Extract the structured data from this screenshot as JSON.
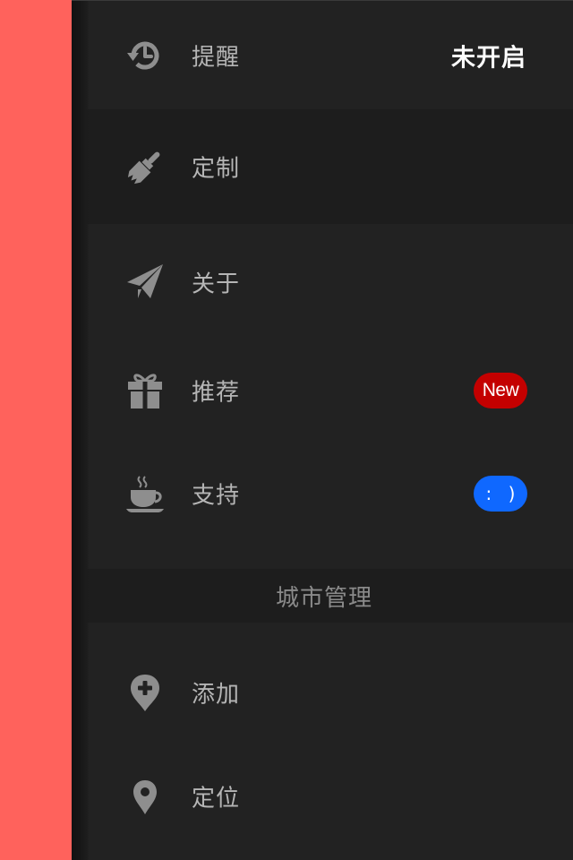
{
  "menu": {
    "items": [
      {
        "label": "提醒",
        "icon": "history-icon",
        "status": "未开启"
      },
      {
        "label": "定制",
        "icon": "brush-icon"
      },
      {
        "label": "关于",
        "icon": "paper-plane-icon"
      },
      {
        "label": "推荐",
        "icon": "gift-icon",
        "badge": "New",
        "badge_color": "#c40000"
      },
      {
        "label": "支持",
        "icon": "coffee-icon",
        "badge": ": )",
        "badge_color": "#0f68ff"
      }
    ]
  },
  "city_section": {
    "title": "城市管理",
    "items": [
      {
        "label": "添加",
        "icon": "map-pin-add-icon"
      },
      {
        "label": "定位",
        "icon": "map-pin-icon"
      }
    ]
  },
  "colors": {
    "background": "#222222",
    "highlight_row": "#1d1d1d",
    "edge_strip": "#ff625c",
    "icon_gray": "#8e8e8e",
    "label_gray": "#b5b5b5"
  }
}
